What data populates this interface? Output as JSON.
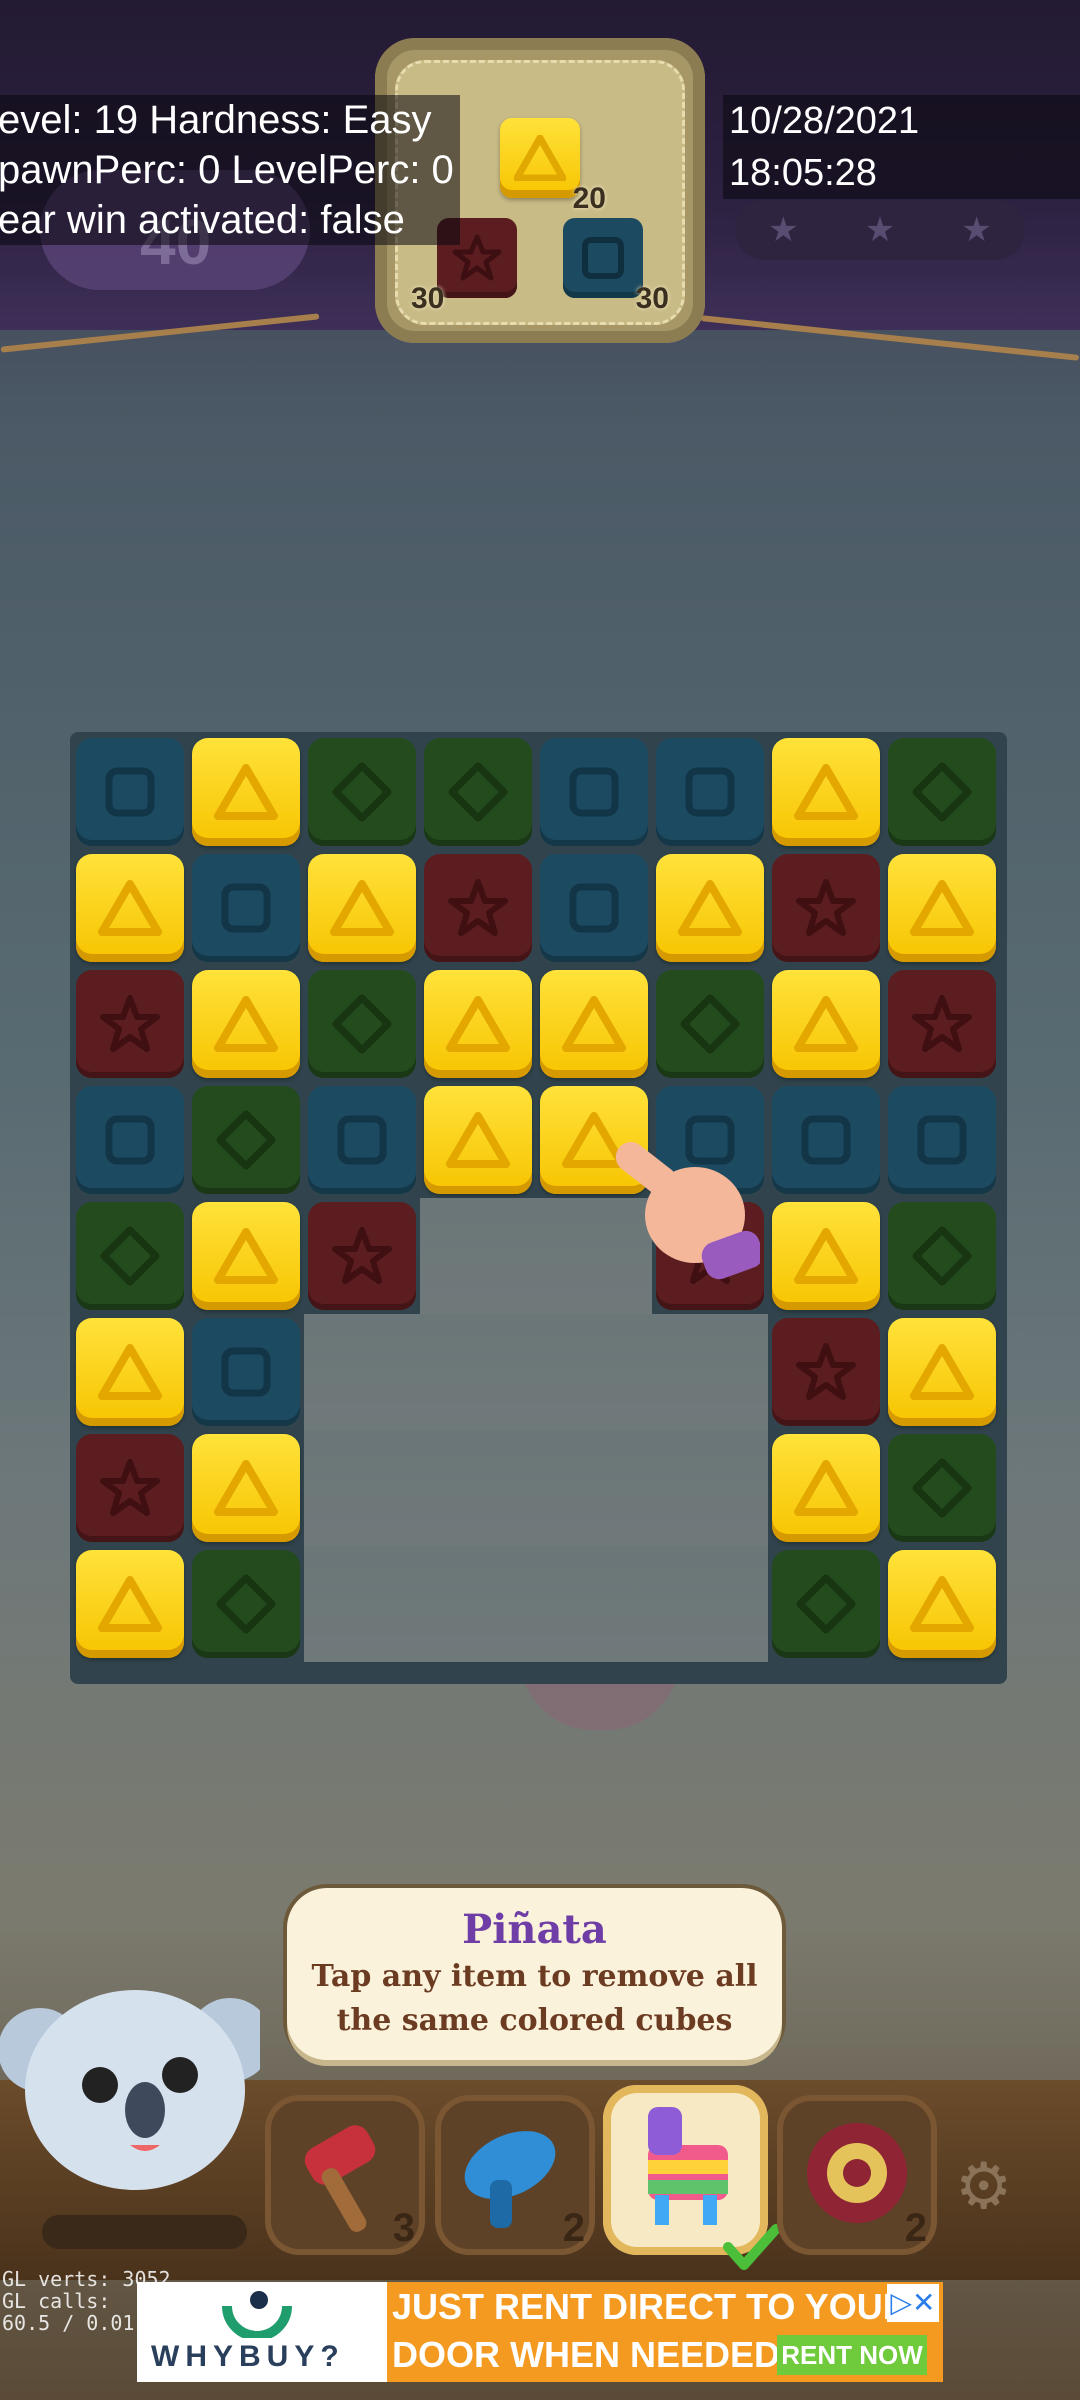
{
  "debug": {
    "line1": "evel: 19 Hardness: Easy",
    "line2": "pawnPerc: 0 LevelPerc: 0",
    "line3": "ear win activated: false"
  },
  "datetime": "10/28/2021 18:05:28",
  "hud": {
    "moves_left": "40",
    "goals": [
      {
        "color": "yellow",
        "shape": "triangle",
        "count": "20"
      },
      {
        "color": "red",
        "shape": "star",
        "count": "30"
      },
      {
        "color": "blue",
        "shape": "square",
        "count": "30"
      }
    ]
  },
  "board": {
    "rows": [
      [
        "blue",
        "yellow",
        "green",
        "green",
        "blue",
        "blue",
        "yellow",
        "green"
      ],
      [
        "yellow",
        "blue",
        "yellow",
        "red",
        "blue",
        "yellow",
        "red",
        "yellow"
      ],
      [
        "red",
        "yellow",
        "green",
        "yellow",
        "yellow",
        "green",
        "yellow",
        "red"
      ],
      [
        "blue",
        "green",
        "blue",
        "yellow",
        "yellow",
        "blue",
        "blue",
        "blue"
      ],
      [
        "green",
        "yellow",
        "red",
        null,
        null,
        "red",
        "yellow",
        "green"
      ],
      [
        "yellow",
        "blue",
        null,
        null,
        null,
        null,
        "red",
        "yellow"
      ],
      [
        "red",
        "yellow",
        null,
        null,
        null,
        null,
        "yellow",
        "green"
      ],
      [
        "yellow",
        "green",
        null,
        null,
        null,
        null,
        "green",
        "yellow"
      ]
    ]
  },
  "tooltip": {
    "title": "Piñata",
    "line1": "Tap any item to remove all",
    "line2": "the same colored cubes"
  },
  "boosters": [
    {
      "name": "hammer",
      "count": "3"
    },
    {
      "name": "blaster",
      "count": "2"
    },
    {
      "name": "pinata",
      "count": "",
      "selected": true
    },
    {
      "name": "yoyo",
      "count": "2"
    }
  ],
  "fps": {
    "line1": "GL verts:  3052",
    "line2": "GL calls:",
    "line3": "60.5 / 0.01"
  },
  "ad": {
    "brand": "WHYBUY?",
    "line1": "JUST RENT DIRECT TO YOUR",
    "line2": "DOOR WHEN NEEDED",
    "cta": "RENT NOW"
  }
}
